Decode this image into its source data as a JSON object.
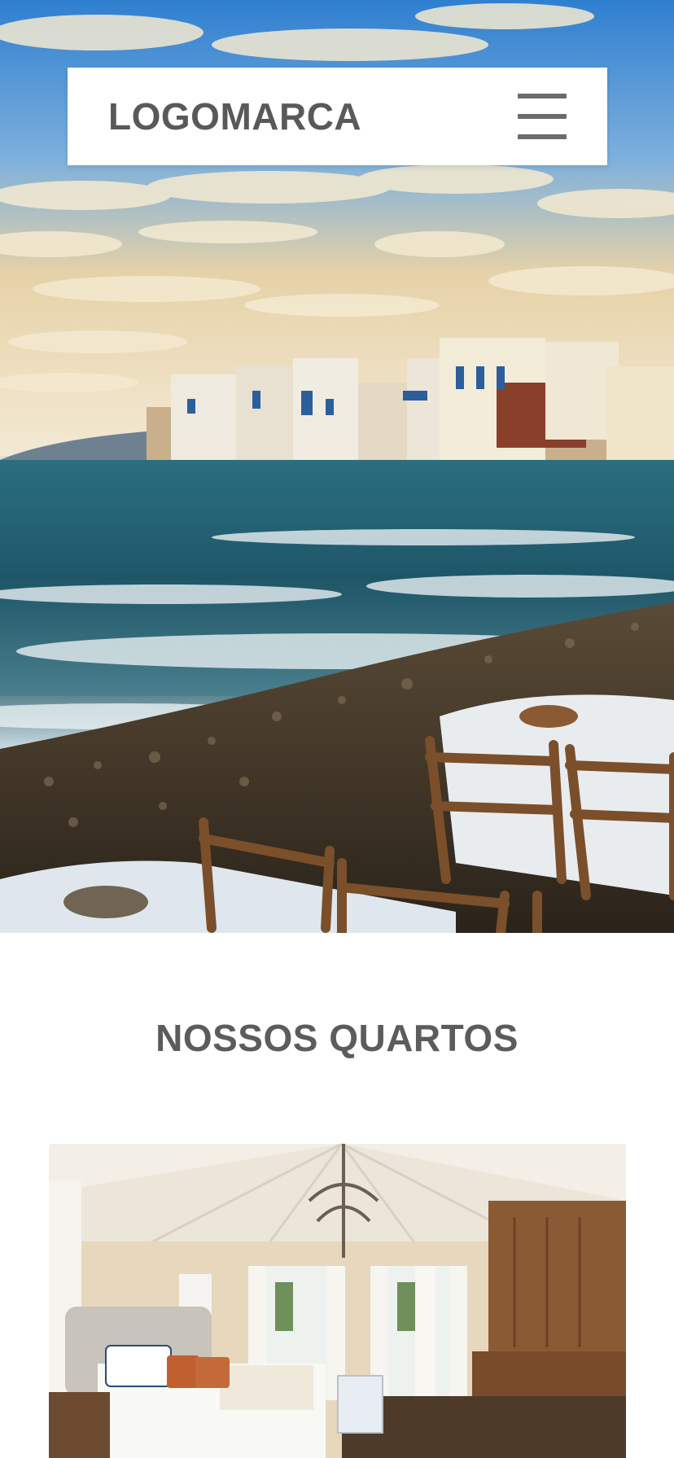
{
  "header": {
    "logo_text": "LOGOMARCA",
    "menu_icon": "hamburger-menu-icon"
  },
  "hero": {
    "image_description": ""
  },
  "rooms_section": {
    "title": "NOSSOS QUARTOS"
  },
  "colors": {
    "text_gray": "#595959",
    "background": "#ffffff",
    "card_background": "#ffffff"
  }
}
